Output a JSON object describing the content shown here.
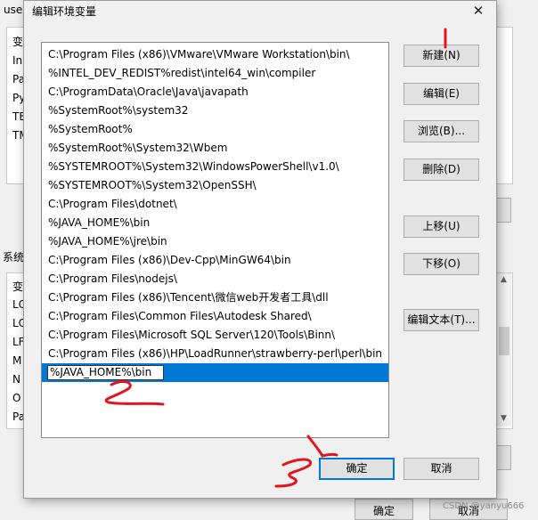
{
  "background_window": {
    "title": "user",
    "user_rows": [
      "变",
      "In",
      "Pa",
      "Py",
      "TE",
      "TM"
    ],
    "system_label": "系统",
    "system_rows": [
      "变",
      "LC",
      "LC",
      "LF",
      "M",
      "N",
      "O",
      "Pa"
    ],
    "ok_label": "确定",
    "cancel_label": "取消"
  },
  "dialog": {
    "title": "编辑环境变量",
    "close_glyph": "✕",
    "entries": [
      "C:\\Program Files (x86)\\VMware\\VMware Workstation\\bin\\",
      "%INTEL_DEV_REDIST%redist\\intel64_win\\compiler",
      "C:\\ProgramData\\Oracle\\Java\\javapath",
      "%SystemRoot%\\system32",
      "%SystemRoot%",
      "%SystemRoot%\\System32\\Wbem",
      "%SYSTEMROOT%\\System32\\WindowsPowerShell\\v1.0\\",
      "%SYSTEMROOT%\\System32\\OpenSSH\\",
      "C:\\Program Files\\dotnet\\",
      "%JAVA_HOME%\\bin",
      "%JAVA_HOME%\\jre\\bin",
      "C:\\Program Files (x86)\\Dev-Cpp\\MinGW64\\bin",
      "C:\\Program Files\\nodejs\\",
      "C:\\Program Files (x86)\\Tencent\\微信web开发者工具\\dll",
      "C:\\Program Files\\Common Files\\Autodesk Shared\\",
      "C:\\Program Files\\Microsoft SQL Server\\120\\Tools\\Binn\\",
      "C:\\Program Files (x86)\\HP\\LoadRunner\\strawberry-perl\\perl\\bin"
    ],
    "editing_value": "%JAVA_HOME%\\bin",
    "buttons": {
      "new": "新建(N)",
      "edit": "编辑(E)",
      "browse": "浏览(B)...",
      "delete": "删除(D)",
      "move_up": "上移(U)",
      "move_down": "下移(O)",
      "edit_text": "编辑文本(T)...",
      "ok": "确定",
      "cancel": "取消"
    }
  },
  "watermark": "CSDN @yanyu666",
  "colors": {
    "selection": "#0078d7",
    "annotation": "#e0161e"
  }
}
